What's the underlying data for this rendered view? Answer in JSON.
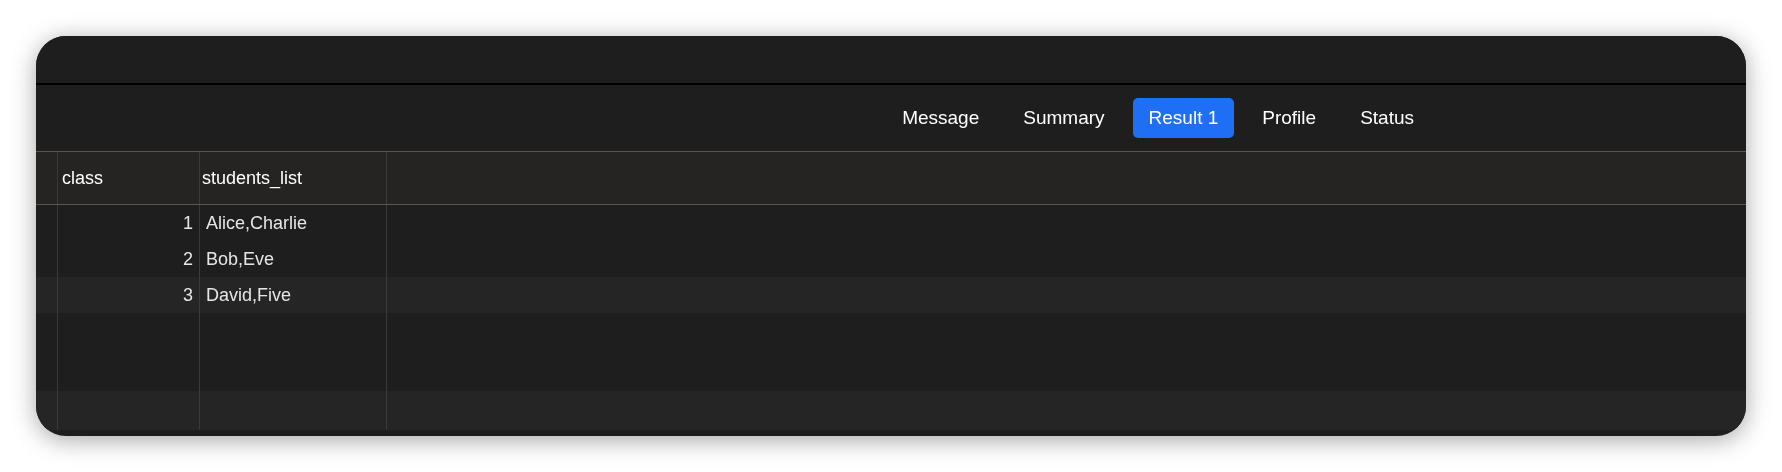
{
  "tabs": [
    {
      "label": "Message",
      "selected": false
    },
    {
      "label": "Summary",
      "selected": false
    },
    {
      "label": "Result 1",
      "selected": true
    },
    {
      "label": "Profile",
      "selected": false
    },
    {
      "label": "Status",
      "selected": false
    }
  ],
  "table": {
    "columns": [
      "class",
      "students_list"
    ],
    "rows": [
      {
        "cells": [
          "1",
          "Alice,Charlie"
        ]
      },
      {
        "cells": [
          "2",
          "Bob,Eve"
        ]
      },
      {
        "cells": [
          "3",
          "David,Five"
        ]
      }
    ]
  }
}
